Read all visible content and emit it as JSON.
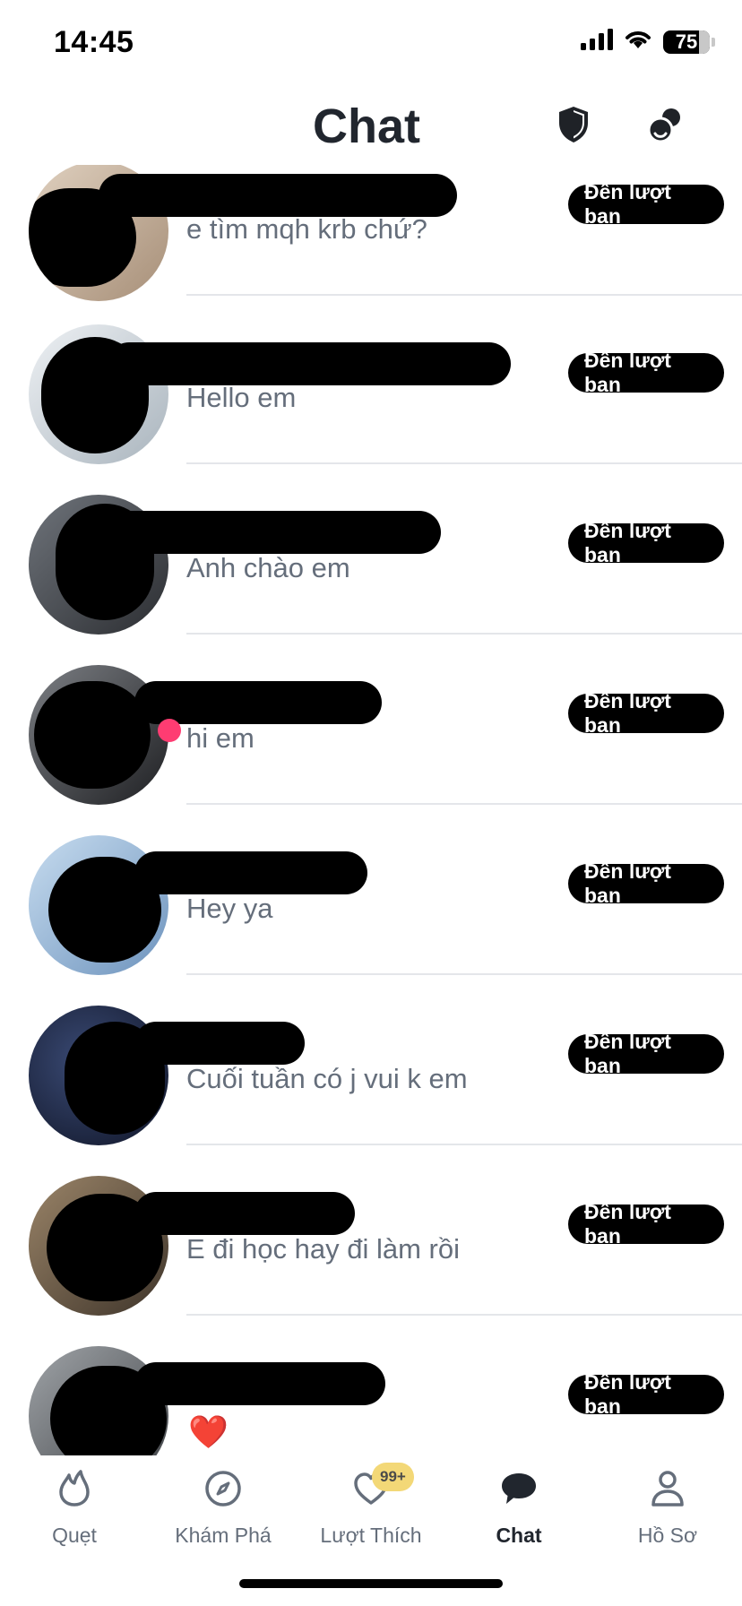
{
  "status_bar": {
    "time": "14:45",
    "battery": "75"
  },
  "header": {
    "title": "Chat",
    "shield_icon": "shield-icon",
    "people_icon": "people-icon"
  },
  "conversations": [
    {
      "message": "e tìm mqh krb chứ?",
      "badge": "Đến lượt bạn",
      "avatar_color": "#c9b9a8"
    },
    {
      "message": "Hello em",
      "badge": "Đến lượt bạn",
      "avatar_color": "#d6dde3"
    },
    {
      "message": "Anh chào em",
      "badge": "Đến lượt bạn",
      "avatar_color": "#4a4d52"
    },
    {
      "message": "hi em",
      "badge": "Đến lượt bạn",
      "avatar_color": "#5b5e63"
    },
    {
      "message": "Hey ya",
      "badge": "Đến lượt bạn",
      "avatar_color": "#8fb2d6"
    },
    {
      "message": "Cuối tuần có j vui k em",
      "badge": "Đến lượt bạn",
      "avatar_color": "#1c2338"
    },
    {
      "message": "E đi học hay đi làm rồi",
      "badge": "Đến lượt bạn",
      "avatar_color": "#6b5a45"
    },
    {
      "message": "❤️",
      "badge": "Đến lượt bạn",
      "avatar_color": "#777b80"
    }
  ],
  "bottom_nav": {
    "swipe": "Quẹt",
    "explore": "Khám Phá",
    "likes": "Lượt Thích",
    "likes_count": "99+",
    "chat": "Chat",
    "profile": "Hồ Sơ"
  },
  "colors": {
    "accent": "#fe3c72",
    "badge_bg": "#000000",
    "likes_badge": "#f3d877"
  }
}
